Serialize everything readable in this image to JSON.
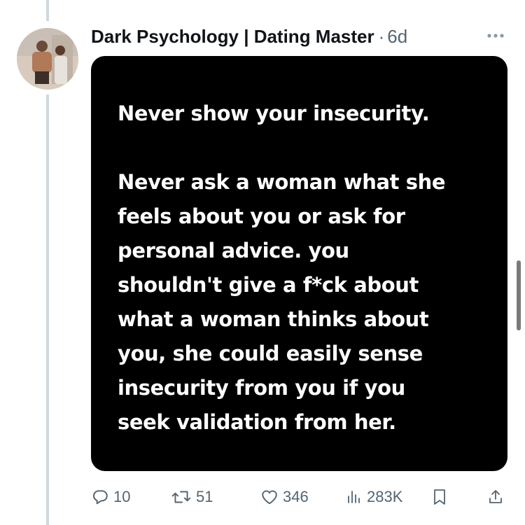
{
  "post": {
    "author": "Dark Psychology | Dating Master",
    "separator": "·",
    "time": "6d",
    "media_text": {
      "headline": "Never show your insecurity.",
      "body_lines": [
        "Never ask a woman what she",
        "feels about you or ask for",
        "personal advice. you",
        "shouldn't give a f*ck about",
        "what a woman thinks about",
        "you, she could easily sense",
        "insecurity from you if you",
        "seek validation from her."
      ]
    }
  },
  "actions": {
    "replies": "10",
    "reposts": "51",
    "likes": "346",
    "views": "283K"
  },
  "colors": {
    "text_primary": "#0f1419",
    "text_secondary": "#536471",
    "thread_line": "#cfd9de",
    "media_bg": "#000000"
  },
  "icons": [
    "more-icon",
    "reply-icon",
    "repost-icon",
    "like-icon",
    "views-icon",
    "bookmark-icon",
    "share-icon"
  ]
}
